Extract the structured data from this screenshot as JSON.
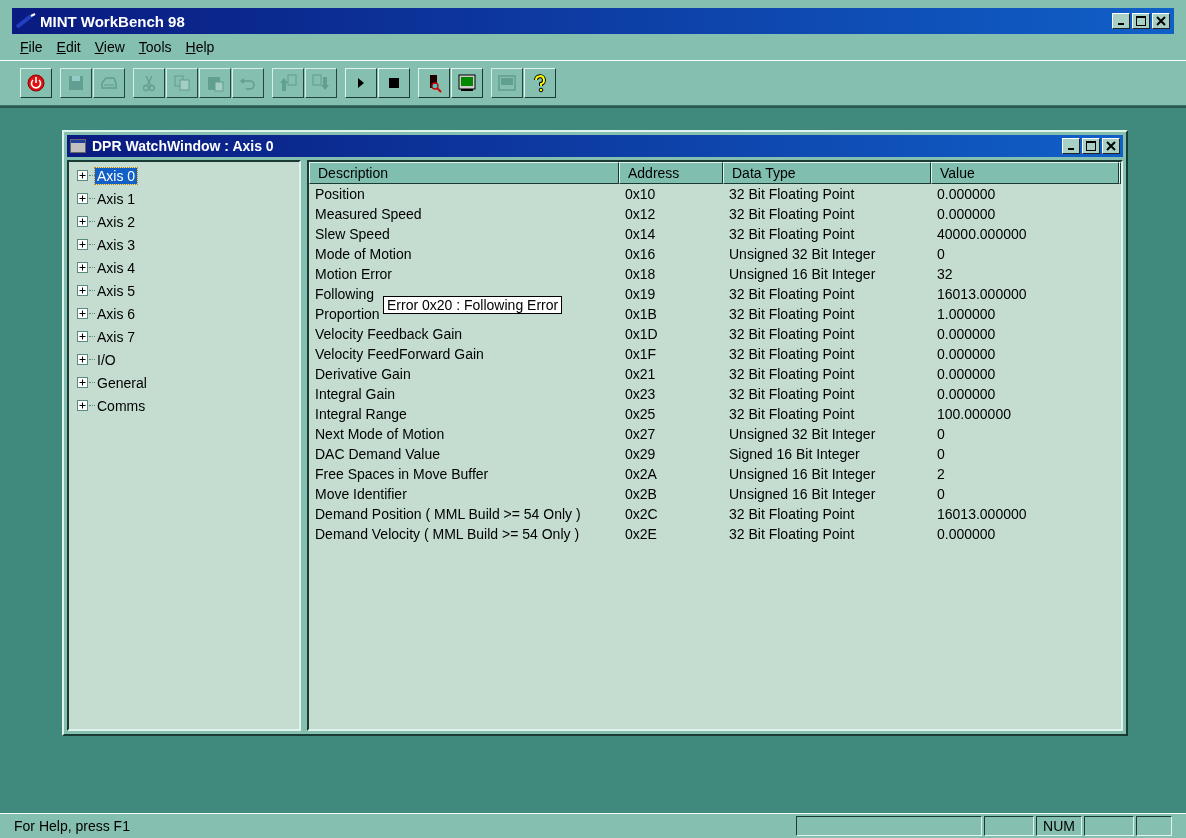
{
  "window": {
    "title": "MINT WorkBench 98"
  },
  "menu": [
    "File",
    "Edit",
    "View",
    "Tools",
    "Help"
  ],
  "toolbar": [
    [
      {
        "kind": "power",
        "disabled": false
      }
    ],
    [
      {
        "kind": "save",
        "disabled": true
      },
      {
        "kind": "print",
        "disabled": true
      }
    ],
    [
      {
        "kind": "cut",
        "disabled": true
      },
      {
        "kind": "copy",
        "disabled": true
      },
      {
        "kind": "paste",
        "disabled": true
      },
      {
        "kind": "undo",
        "disabled": true
      }
    ],
    [
      {
        "kind": "upload",
        "disabled": true
      },
      {
        "kind": "download",
        "disabled": true
      }
    ],
    [
      {
        "kind": "play",
        "disabled": false
      },
      {
        "kind": "stop",
        "disabled": false
      }
    ],
    [
      {
        "kind": "scope",
        "disabled": false
      },
      {
        "kind": "monitor",
        "disabled": false
      }
    ],
    [
      {
        "kind": "terminal",
        "disabled": true
      },
      {
        "kind": "help",
        "disabled": false
      }
    ]
  ],
  "child_window": {
    "title": "DPR WatchWindow : Axis 0",
    "tree": [
      {
        "label": "Axis 0",
        "selected": true,
        "expanded": false
      },
      {
        "label": "Axis 1",
        "selected": false,
        "expanded": false
      },
      {
        "label": "Axis 2",
        "selected": false,
        "expanded": false
      },
      {
        "label": "Axis 3",
        "selected": false,
        "expanded": false
      },
      {
        "label": "Axis 4",
        "selected": false,
        "expanded": false
      },
      {
        "label": "Axis 5",
        "selected": false,
        "expanded": false
      },
      {
        "label": "Axis 6",
        "selected": false,
        "expanded": false
      },
      {
        "label": "Axis 7",
        "selected": false,
        "expanded": false
      },
      {
        "label": "I/O",
        "selected": false,
        "expanded": false
      },
      {
        "label": "General",
        "selected": false,
        "expanded": false
      },
      {
        "label": "Comms",
        "selected": false,
        "expanded": false
      }
    ],
    "table": {
      "columns": [
        "Description",
        "Address",
        "Data Type",
        "Value"
      ],
      "rows": [
        [
          "Position",
          "0x10",
          "32 Bit Floating Point",
          "0.000000"
        ],
        [
          "Measured Speed",
          "0x12",
          "32 Bit Floating Point",
          "0.000000"
        ],
        [
          "Slew Speed",
          "0x14",
          "32 Bit Floating Point",
          "40000.000000"
        ],
        [
          "Mode of Motion",
          "0x16",
          "Unsigned 32 Bit Integer",
          "0"
        ],
        [
          "Motion Error",
          "0x18",
          "Unsigned 16 Bit Integer",
          "32"
        ],
        [
          "Following",
          "0x19",
          "32 Bit Floating Point",
          "16013.000000"
        ],
        [
          "Proportion",
          "0x1B",
          "32 Bit Floating Point",
          "1.000000"
        ],
        [
          "Velocity Feedback Gain",
          "0x1D",
          "32 Bit Floating Point",
          "0.000000"
        ],
        [
          "Velocity FeedForward Gain",
          "0x1F",
          "32 Bit Floating Point",
          "0.000000"
        ],
        [
          "Derivative Gain",
          "0x21",
          "32 Bit Floating Point",
          "0.000000"
        ],
        [
          "Integral Gain",
          "0x23",
          "32 Bit Floating Point",
          "0.000000"
        ],
        [
          "Integral Range",
          "0x25",
          "32 Bit Floating Point",
          "100.000000"
        ],
        [
          "Next Mode of Motion",
          "0x27",
          "Unsigned 32 Bit Integer",
          "0"
        ],
        [
          "DAC Demand Value",
          "0x29",
          "Signed 16 Bit Integer",
          "0"
        ],
        [
          "Free Spaces in Move Buffer",
          "0x2A",
          "Unsigned 16 Bit Integer",
          "2"
        ],
        [
          "Move Identifier",
          "0x2B",
          "Unsigned 16 Bit Integer",
          "0"
        ],
        [
          "Demand Position ( MML Build >= 54 Only )",
          "0x2C",
          "32 Bit Floating Point",
          "16013.000000"
        ],
        [
          "Demand Velocity ( MML Build >= 54 Only )",
          "0x2E",
          "32 Bit Floating Point",
          "0.000000"
        ]
      ]
    },
    "tooltip": "Error 0x20 : Following Error"
  },
  "status_bar": {
    "text": "For Help, press F1",
    "indicators": [
      "NUM"
    ]
  }
}
